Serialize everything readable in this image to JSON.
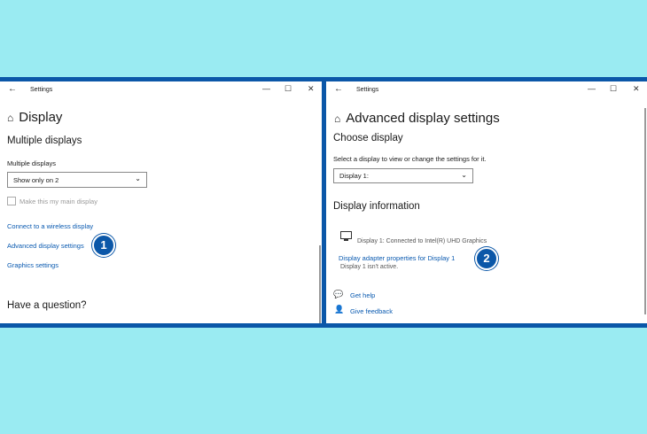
{
  "left": {
    "title": "Settings",
    "page_title": "Display",
    "section": "Multiple displays",
    "dropdown_label": "Multiple displays",
    "dropdown_value": "Show only on 2",
    "checkbox_label": "Make this my main display",
    "links": [
      "Connect to a wireless display",
      "Advanced display settings",
      "Graphics settings"
    ],
    "question": "Have a question?",
    "badge": "1"
  },
  "right": {
    "title": "Settings",
    "page_title": "Advanced display settings",
    "section": "Choose display",
    "instruction": "Select a display to view or change the settings for it.",
    "dropdown_value": "Display 1:",
    "info_heading": "Display information",
    "display_info": "Display 1: Connected to Intel(R) UHD Graphics",
    "adapter_link": "Display adapter properties for Display 1",
    "inactive_note": "Display 1 isn't active.",
    "help": "Get help",
    "feedback": "Give feedback",
    "badge": "2"
  },
  "window_controls": [
    "—",
    "☐",
    "✕"
  ],
  "colors": {
    "background": "#9aebf2",
    "frame": "#0b57a8",
    "link": "#0a5ab0"
  }
}
